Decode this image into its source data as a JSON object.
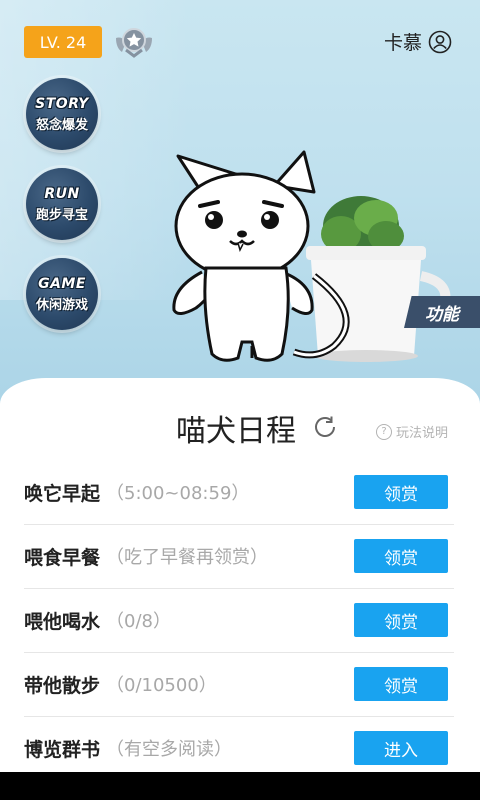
{
  "header": {
    "level_label": "LV. 24",
    "username": "卡慕",
    "icons": {
      "medal": "medal-star-icon",
      "user": "user-circle-icon"
    }
  },
  "side_menu": [
    {
      "en": "STORY",
      "cn": "怒念爆发"
    },
    {
      "en": "RUN",
      "cn": "跑步寻宝"
    },
    {
      "en": "GAME",
      "cn": "休闲游戏"
    }
  ],
  "function_tab": "功能",
  "panel": {
    "title": "喵犬日程",
    "help_label": "玩法说明",
    "help_glyph": "?",
    "tasks": [
      {
        "name": "唤它早起",
        "note": "（5:00~08:59）",
        "button": "领赏"
      },
      {
        "name": "喂食早餐",
        "note": "（吃了早餐再领赏）",
        "button": "领赏"
      },
      {
        "name": "喂他喝水",
        "note": "（0/8）",
        "button": "领赏"
      },
      {
        "name": "带他散步",
        "note": "（0/10500）",
        "button": "领赏"
      },
      {
        "name": "博览群书",
        "note": "（有空多阅读）",
        "button": "进入"
      }
    ]
  },
  "colors": {
    "level_badge": "#f5a31a",
    "task_button": "#19a3f0",
    "side_button": "#2c4a6b",
    "function_tab": "#3a4f6a"
  }
}
